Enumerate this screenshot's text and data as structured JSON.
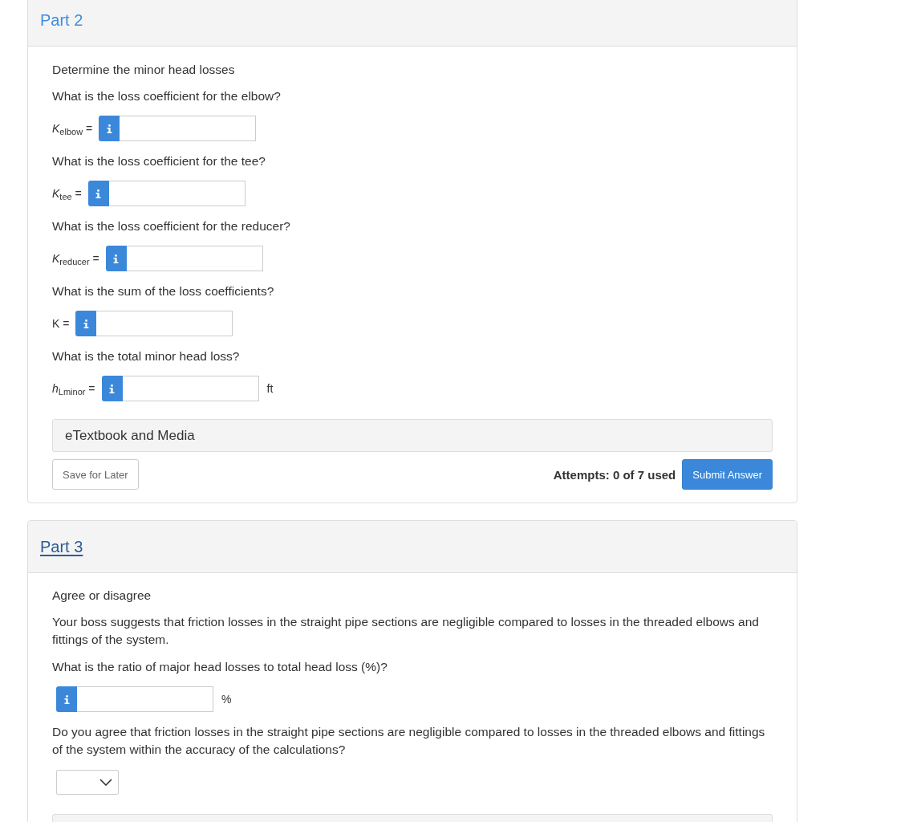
{
  "part2": {
    "title": {
      "text": "Part 2",
      "link": false
    },
    "intro": "Determine the minor head losses",
    "questions": [
      {
        "prompt": "What is the loss coefficient for the elbow?",
        "label": "*K*$_{elbow}$ ="
      },
      {
        "prompt": "What is the loss coefficient for the tee?",
        "label": "*K*$_{tee}$ ="
      },
      {
        "prompt": "What is the loss coefficient for the reducer?",
        "label": "*K*$_{reducer}$ ="
      },
      {
        "prompt": "What is the sum of the loss coefficients?",
        "label": "K ="
      },
      {
        "prompt": "What is the total minor head loss?",
        "label": "*h*$_{Lminor}$ =",
        "unit": "ft"
      }
    ],
    "media_bar": "eTextbook and Media",
    "save_button": "Save for Later",
    "attempts": "Attempts: 0 of 7 used",
    "submit_button": "Submit Answer"
  },
  "part3": {
    "title": {
      "text": "Part 3",
      "link": true
    },
    "intro": "Agree or disagree",
    "paragraph": "Your boss suggests that friction losses in the straight pipe sections are negligible compared to losses in the threaded elbows and fittings of the system.",
    "questions": [
      {
        "kind": "numeric",
        "prompt": "What is the ratio of major head losses to total head loss (%)?",
        "unit": "%"
      },
      {
        "kind": "dropdown",
        "prompt": "Do you agree that friction losses in the straight pipe sections are negligible compared to losses in the threaded elbows and fittings of the system within the accuracy of the calculations?"
      }
    ],
    "trailing_bar": true
  }
}
